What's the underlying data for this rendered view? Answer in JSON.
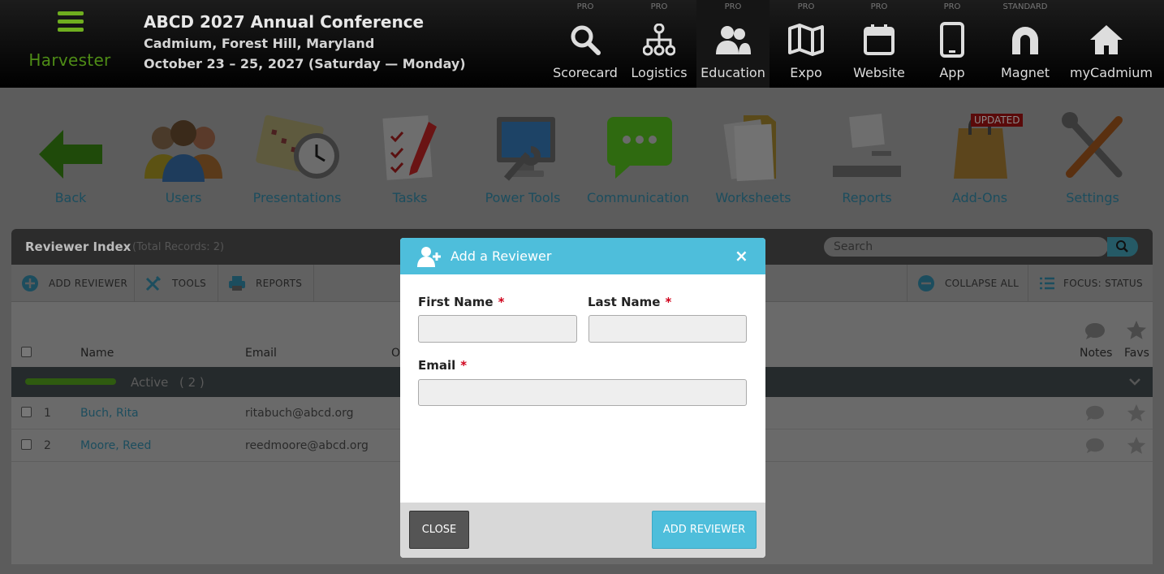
{
  "brand": {
    "name": "Harvester"
  },
  "conference": {
    "title": "ABCD 2027 Annual Conference",
    "location": "Cadmium, Forest Hill, Maryland",
    "dates": "October 23 – 25, 2027 (Saturday — Monday)"
  },
  "nav": [
    {
      "tier": "PRO",
      "label": "Scorecard",
      "icon": "search-icon"
    },
    {
      "tier": "PRO",
      "label": "Logistics",
      "icon": "sitemap-icon"
    },
    {
      "tier": "PRO",
      "label": "Education",
      "icon": "users-icon"
    },
    {
      "tier": "PRO",
      "label": "Expo",
      "icon": "map-icon"
    },
    {
      "tier": "PRO",
      "label": "Website",
      "icon": "calendar-icon"
    },
    {
      "tier": "PRO",
      "label": "App",
      "icon": "phone-icon"
    },
    {
      "tier": "STANDARD",
      "label": "Magnet",
      "icon": "magnet-icon"
    },
    {
      "tier": "",
      "label": "myCadmium",
      "icon": "home-icon"
    }
  ],
  "toolbar": [
    {
      "label": "Back",
      "icon": "back-arrow-icon"
    },
    {
      "label": "Users",
      "icon": "users-group-icon"
    },
    {
      "label": "Presentations",
      "icon": "calendar-clock-icon"
    },
    {
      "label": "Tasks",
      "icon": "checklist-icon"
    },
    {
      "label": "Power Tools",
      "icon": "monitor-wrench-icon"
    },
    {
      "label": "Communication",
      "icon": "chat-bubble-icon"
    },
    {
      "label": "Worksheets",
      "icon": "folder-icon"
    },
    {
      "label": "Reports",
      "icon": "printer-icon"
    },
    {
      "label": "Add-Ons",
      "icon": "shopping-bag-icon",
      "badge": "UPDATED"
    },
    {
      "label": "Settings",
      "icon": "tools-icon"
    }
  ],
  "panel": {
    "title": "Reviewer Index",
    "count": "(Total Records: 2)",
    "search_placeholder": "Search",
    "buttons": {
      "add": "ADD REVIEWER",
      "tools": "TOOLS",
      "reports": "REPORTS",
      "collapse": "COLLAPSE ALL",
      "focus": "FOCUS: STATUS"
    },
    "columns": {
      "name": "Name",
      "email": "Email",
      "other": "O",
      "notes": "Notes",
      "favs": "Favs"
    },
    "group": {
      "label": "Active",
      "count": "( 2 )"
    },
    "rows": [
      {
        "num": "1",
        "name": "Buch, Rita",
        "email": "ritabuch@abcd.org"
      },
      {
        "num": "2",
        "name": "Moore, Reed",
        "email": "reedmoore@abcd.org"
      }
    ]
  },
  "modal": {
    "title": "Add a Reviewer",
    "first_name_label": "First Name",
    "last_name_label": "Last Name",
    "email_label": "Email",
    "required_mark": "*",
    "first_name_value": "",
    "last_name_value": "",
    "email_value": "",
    "close_label": "CLOSE",
    "submit_label": "ADD REVIEWER",
    "accent_color": "#4ebedb"
  }
}
